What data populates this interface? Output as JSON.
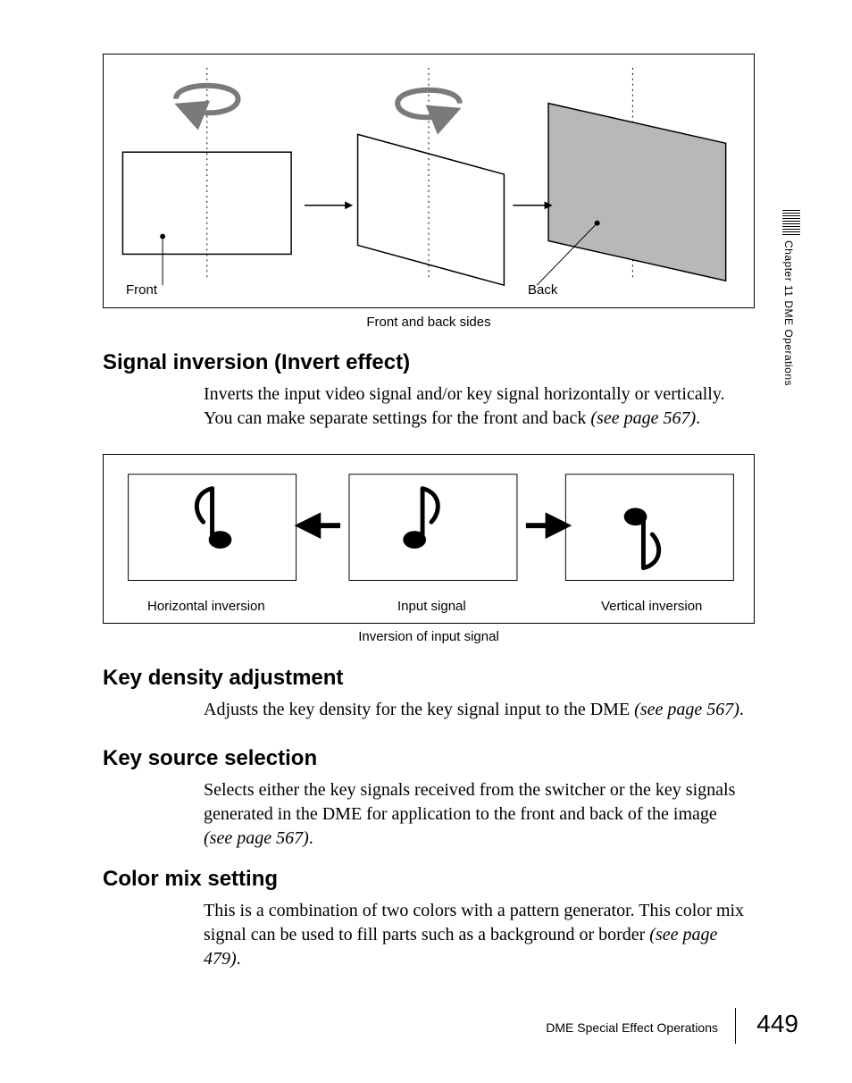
{
  "side_tab": {
    "chapter_label": "Chapter 11   DME Operations"
  },
  "figure1": {
    "front_label": "Front",
    "back_label": "Back",
    "caption": "Front and back sides"
  },
  "section_signal_inversion": {
    "heading": "Signal inversion (Invert effect)",
    "body_pre": "Inverts the input video signal and/or key signal horizontally or vertically. You can make separate settings for the front and back ",
    "body_ital": "(see page 567)",
    "body_post": "."
  },
  "figure2": {
    "h_inv_label": "Horizontal inversion",
    "input_label": "Input signal",
    "v_inv_label": "Vertical inversion",
    "caption": "Inversion of input signal"
  },
  "section_key_density": {
    "heading": "Key density adjustment",
    "body_pre": "Adjusts the key density for the key signal input to the DME ",
    "body_ital": "(see page 567)",
    "body_post": "."
  },
  "section_key_source": {
    "heading": "Key source selection",
    "body_pre": "Selects either the key signals received from the switcher or the key signals generated in the DME for application to the front and back of the image  ",
    "body_ital": "(see page 567)",
    "body_post": "."
  },
  "section_color_mix": {
    "heading": "Color mix setting",
    "body_pre": "This is a combination of two colors with a pattern generator. This color mix signal can be used to fill parts such as a background or border ",
    "body_ital": "(see page 479)",
    "body_post": "."
  },
  "footer": {
    "section_name": "DME Special Effect Operations",
    "page_number": "449"
  }
}
